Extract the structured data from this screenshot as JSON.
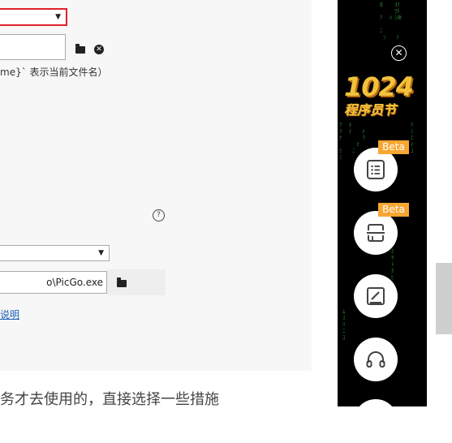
{
  "settings": {
    "filename_hint": "me}` 表示当前文件名）",
    "exe_path": "o\\PicGo.exe",
    "doc_link": "说明",
    "help_glyph": "?",
    "bottom_text": "务才去使用的，直接选择一些措施"
  },
  "sidebar": {
    "close_glyph": "✕",
    "logo_number": "1024",
    "logo_text": "程序员节",
    "badges": [
      "Beta",
      "Beta"
    ],
    "buttons": [
      "list-icon",
      "scan-icon",
      "edit-icon",
      "headset-icon"
    ]
  },
  "colors": {
    "accent_red": "#e0202c",
    "beta_orange": "#f7a632",
    "logo_gold": "#f3c23c",
    "link_blue": "#1a5fb4"
  }
}
